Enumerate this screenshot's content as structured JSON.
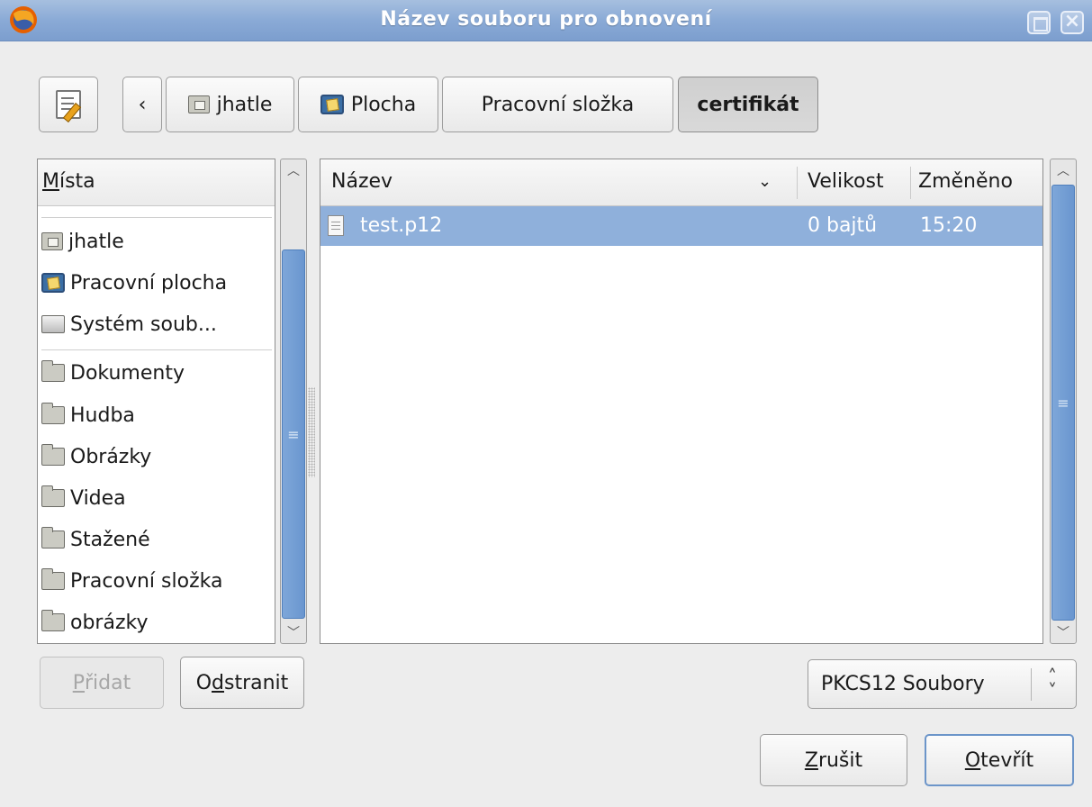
{
  "window": {
    "title": "Název souboru pro obnovení"
  },
  "pathbar": {
    "back_symbol": "‹",
    "crumbs": [
      "jhatle",
      "Plocha",
      "Pracovní složka",
      "certifikát"
    ]
  },
  "places": {
    "header": "Místa",
    "header_mnemonic": "M",
    "header_rest": "ísta",
    "items": [
      {
        "label": "jhatle",
        "icon": "home-folder-icon"
      },
      {
        "label": "Pracovní plocha",
        "icon": "desktop-icon"
      },
      {
        "label": "Systém soub...",
        "icon": "drive-icon"
      },
      {
        "label": "Dokumenty",
        "icon": "folder-icon"
      },
      {
        "label": "Hudba",
        "icon": "folder-icon"
      },
      {
        "label": "Obrázky",
        "icon": "folder-icon"
      },
      {
        "label": "Videa",
        "icon": "folder-icon"
      },
      {
        "label": "Stažené",
        "icon": "folder-icon"
      },
      {
        "label": "Pracovní složka",
        "icon": "folder-icon"
      },
      {
        "label": "obrázky",
        "icon": "folder-icon"
      }
    ]
  },
  "files": {
    "columns": {
      "name": "Název",
      "size": "Velikost",
      "modified": "Změněno"
    },
    "rows": [
      {
        "name": "test.p12",
        "size": "0 bajtů",
        "modified": "15:20"
      }
    ]
  },
  "buttons": {
    "add": {
      "mnemonic": "P",
      "rest": "řidat"
    },
    "remove": {
      "pre": "O",
      "mnemonic": "d",
      "rest": "stranit"
    },
    "cancel": {
      "mnemonic": "Z",
      "rest": "rušit"
    },
    "open": {
      "mnemonic": "O",
      "rest": "tevřít"
    }
  },
  "filter": {
    "selected": "PKCS12 Soubory"
  },
  "colors": {
    "titlebar": "#8aaad6",
    "selection": "#8fb0db",
    "scroll_thumb": "#7ea7d9"
  }
}
